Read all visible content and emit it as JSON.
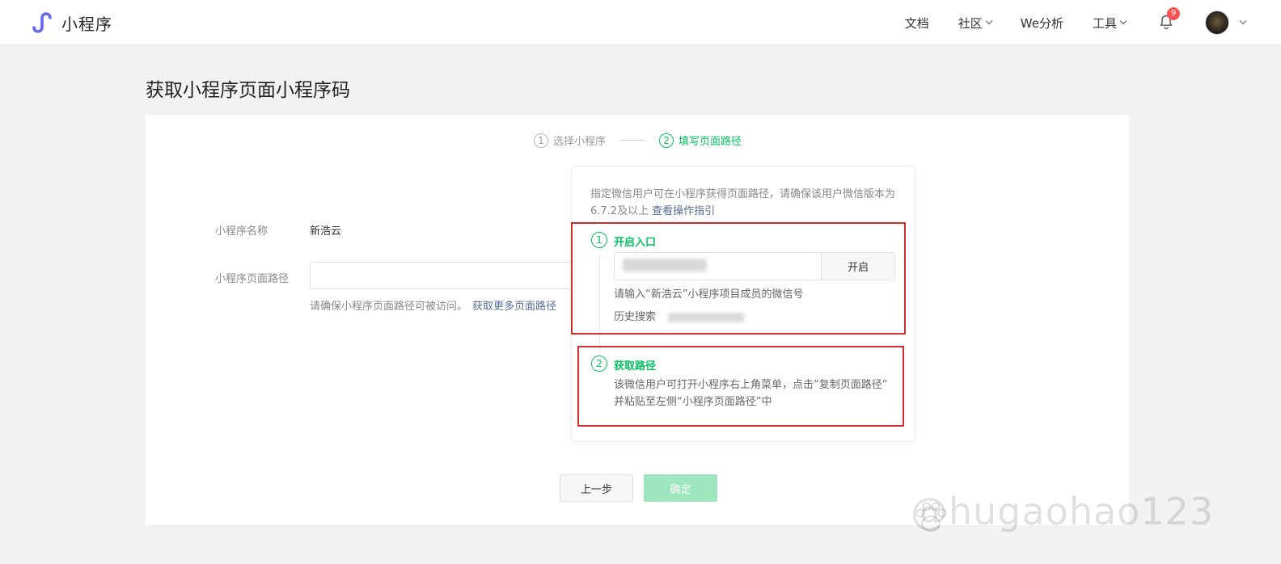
{
  "app": {
    "logo_text": "小程序",
    "brand_color": "#07c160",
    "logo_color": "#6467f0"
  },
  "nav": {
    "items": [
      {
        "label": "文档",
        "dropdown": false
      },
      {
        "label": "社区",
        "dropdown": true
      },
      {
        "label": "We分析",
        "dropdown": false
      },
      {
        "label": "工具",
        "dropdown": true
      }
    ],
    "notification_count": "9"
  },
  "page": {
    "title": "获取小程序页面小程序码"
  },
  "steps": [
    {
      "num": "1",
      "label": "选择小程序",
      "active": false
    },
    {
      "num": "2",
      "label": "填写页面路径",
      "active": true
    }
  ],
  "form": {
    "name_label": "小程序名称",
    "name_value": "新浩云",
    "path_label": "小程序页面路径",
    "path_value": "",
    "path_hint": "请确保小程序页面路径可被访问。",
    "path_hint_link": "获取更多页面路径"
  },
  "popover": {
    "description": "指定微信用户可在小程序获得页面路径，请确保该用户微信版本为6.7.2及以上",
    "guide_link": "查看操作指引",
    "section1": {
      "num": "1",
      "title": "开启入口",
      "input_value": "",
      "button_label": "开启",
      "input_hint": "请输入“新浩云”小程序项目成员的微信号",
      "history_label": "历史搜索"
    },
    "section2": {
      "num": "2",
      "title": "获取路径",
      "text_line1": "该微信用户可打开小程序右上角菜单，点击“复制页面路径”",
      "text_line2": "并粘贴至左侧“小程序页面路径”中"
    }
  },
  "buttons": {
    "prev_label": "上一步",
    "ok_label": "确定"
  },
  "watermark": "@hugaohao123",
  "annotation_color": "#d32d2d"
}
